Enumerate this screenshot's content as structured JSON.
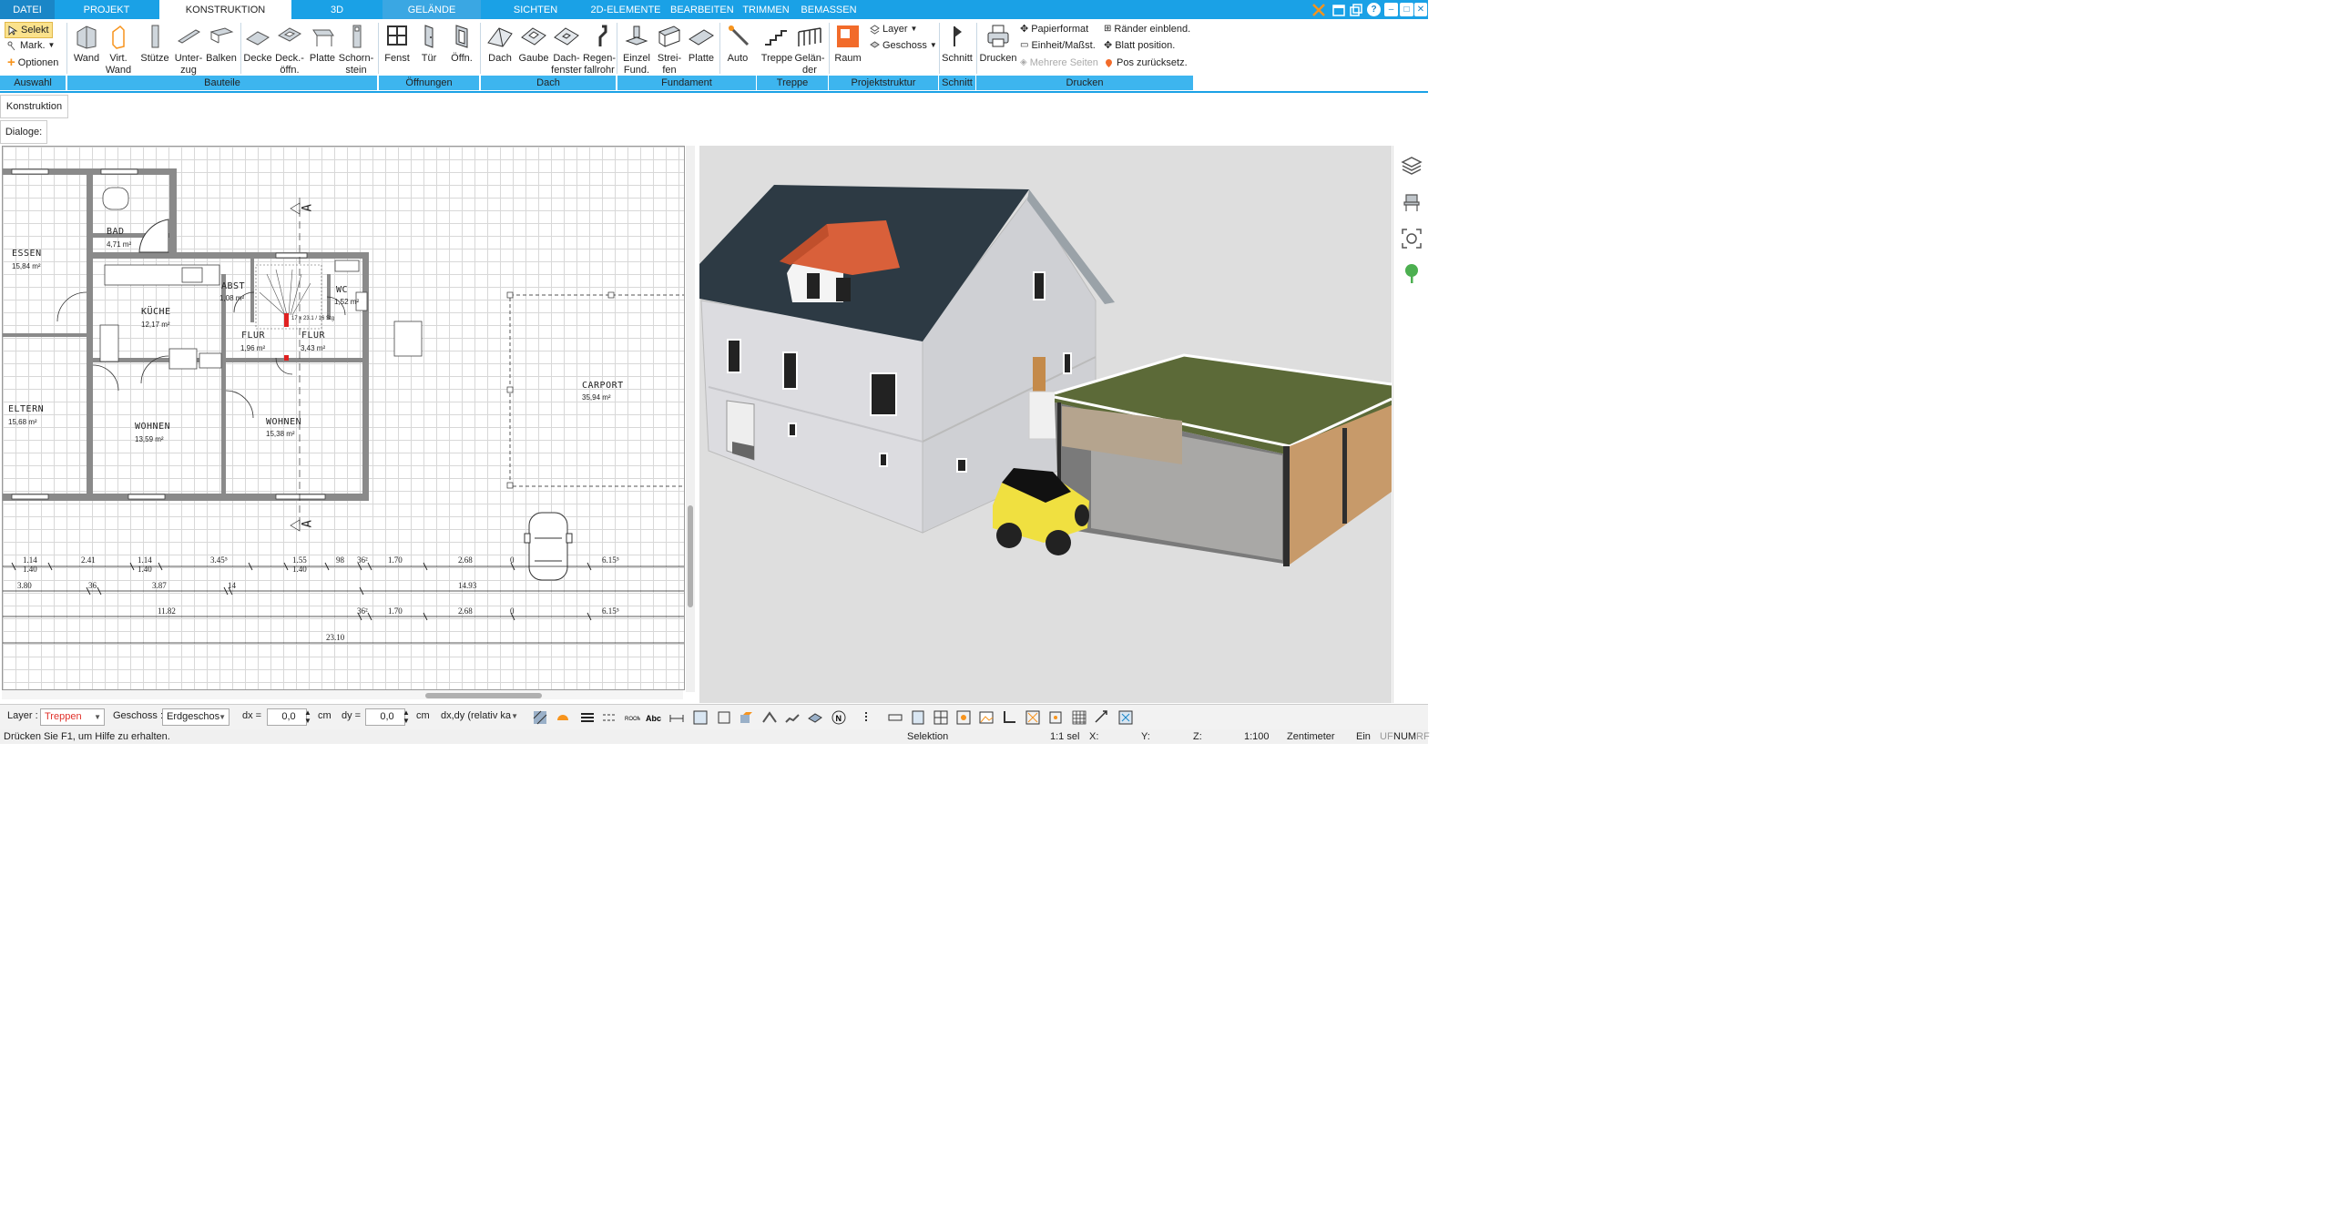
{
  "menu": {
    "tabs": [
      {
        "label": "DATEI"
      },
      {
        "label": "PROJEKT"
      },
      {
        "label": "KONSTRUKTION"
      },
      {
        "label": "3D"
      },
      {
        "label": "GELÄNDE"
      },
      {
        "label": "SICHTEN"
      },
      {
        "label": "2D-ELEMENTE"
      },
      {
        "label": "BEARBEITEN"
      },
      {
        "label": "TRIMMEN"
      },
      {
        "label": "BEMASSEN"
      }
    ],
    "active_tab": "KONSTRUKTION",
    "help": "?"
  },
  "ribbon": {
    "auswahl": {
      "selekt": "Selekt",
      "mark": "Mark.",
      "optionen": "Optionen",
      "group": "Auswahl"
    },
    "bauteile": {
      "wand": "Wand",
      "virt1": "Virt.",
      "virt2": "Wand",
      "stuetze": "Stütze",
      "unter1": "Unter-",
      "unter2": "zug",
      "balken": "Balken",
      "decke": "Decke",
      "deck1": "Deck.-",
      "deck2": "öffn.",
      "platte": "Platte",
      "schorn1": "Schorn-",
      "schorn2": "stein",
      "group": "Bauteile"
    },
    "oeffnungen": {
      "fenst": "Fenst",
      "tuer": "Tür",
      "oeffn": "Öffn.",
      "group": "Öffnungen"
    },
    "dach": {
      "dach": "Dach",
      "gaube": "Gaube",
      "dfen1": "Dach-",
      "dfen2": "fenster",
      "regen1": "Regen-",
      "regen2": "fallrohr",
      "group": "Dach"
    },
    "fundament": {
      "einzel1": "Einzel",
      "einzel2": "Fund.",
      "strei1": "Strei-",
      "strei2": "fen",
      "platte": "Platte",
      "group": "Fundament"
    },
    "auto": {
      "label": "Auto"
    },
    "treppe": {
      "treppe": "Treppe",
      "gel1": "Gelän-",
      "gel2": "der",
      "group": "Treppe"
    },
    "projekt": {
      "raum": "Raum",
      "layer": "Layer",
      "geschoss": "Geschoss",
      "group": "Projektstruktur"
    },
    "schnitt": {
      "label": "Schnitt",
      "group": "Schnitt"
    },
    "drucken": {
      "drucken": "Drucken",
      "papier": "Papierformat",
      "einheit": "Einheit/Maßst.",
      "mehrere": "Mehrere Seiten",
      "raender": "Ränder einblend.",
      "blatt": "Blatt position.",
      "pos": "Pos zurücksetz.",
      "group": "Drucken"
    }
  },
  "panel_tabs": {
    "konstruktion": "Konstruktion",
    "dialoge": "Dialoge:"
  },
  "plan": {
    "rooms": [
      {
        "name": "ESSEN",
        "area": "15,84 m²"
      },
      {
        "name": "BAD",
        "area": "4,71 m²"
      },
      {
        "name": "KÜCHE",
        "area": "12,17 m²"
      },
      {
        "name": "ABST",
        "area": "1,08 m²"
      },
      {
        "name": "WC",
        "area": "1,52 m²"
      },
      {
        "name": "FLUR",
        "area": "1,96 m²"
      },
      {
        "name": "FLUR",
        "area": "3,43 m²"
      },
      {
        "name": "ELTERN",
        "area": "15,68 m²"
      },
      {
        "name": "WOHNEN",
        "area": "13,59 m²"
      },
      {
        "name": "WOHNEN",
        "area": "15,38 m²"
      },
      {
        "name": "CARPORT",
        "area": "35,94 m²"
      }
    ],
    "section_mark": "A",
    "dims_row1": [
      "1.14",
      "2.41",
      "1.14",
      "3.45⁵",
      "1.55",
      "98",
      "36²",
      "1.70",
      "2.68",
      "0",
      "6.15⁵"
    ],
    "dims_row1b": [
      "1.40",
      "1.40",
      "1.40"
    ],
    "dims_row2": [
      "3.80",
      "36",
      "3.87",
      "14",
      "14.93"
    ],
    "dims_row3": [
      "11.82",
      "36²",
      "1.70",
      "2.68",
      "0",
      "6.15⁵"
    ],
    "dims_row4": [
      "23.10"
    ],
    "stair_text": "17 x 23.1 / 16 Stg"
  },
  "toolbar": {
    "layer_label": "Layer :",
    "layer_value": "Treppen",
    "geschoss_label": "Geschoss :",
    "geschoss_value": "Erdgeschos",
    "dx_label": "dx =",
    "dx_value": "0,0",
    "dx_unit": "cm",
    "dy_label": "dy =",
    "dy_value": "0,0",
    "dy_unit": "cm",
    "mode_value": "dx,dy (relativ ka",
    "layer_color": "#e0302a"
  },
  "status": {
    "help": "Drücken Sie F1, um Hilfe zu erhalten.",
    "selektion": "Selektion",
    "sel": "1:1 sel",
    "x": "X:",
    "y": "Y:",
    "z": "Z:",
    "scale": "1:100",
    "unit": "Zentimeter",
    "ein": "Ein",
    "uf": "UF",
    "num": "NUM",
    "rf": "RF"
  },
  "colors": {
    "accent": "#1aa1e6",
    "group_bar": "#3db5ef",
    "roof": "#2d3a44",
    "dormer_roof": "#d9603a",
    "carport_roof": "#5c6a38",
    "car": "#f0e040"
  }
}
